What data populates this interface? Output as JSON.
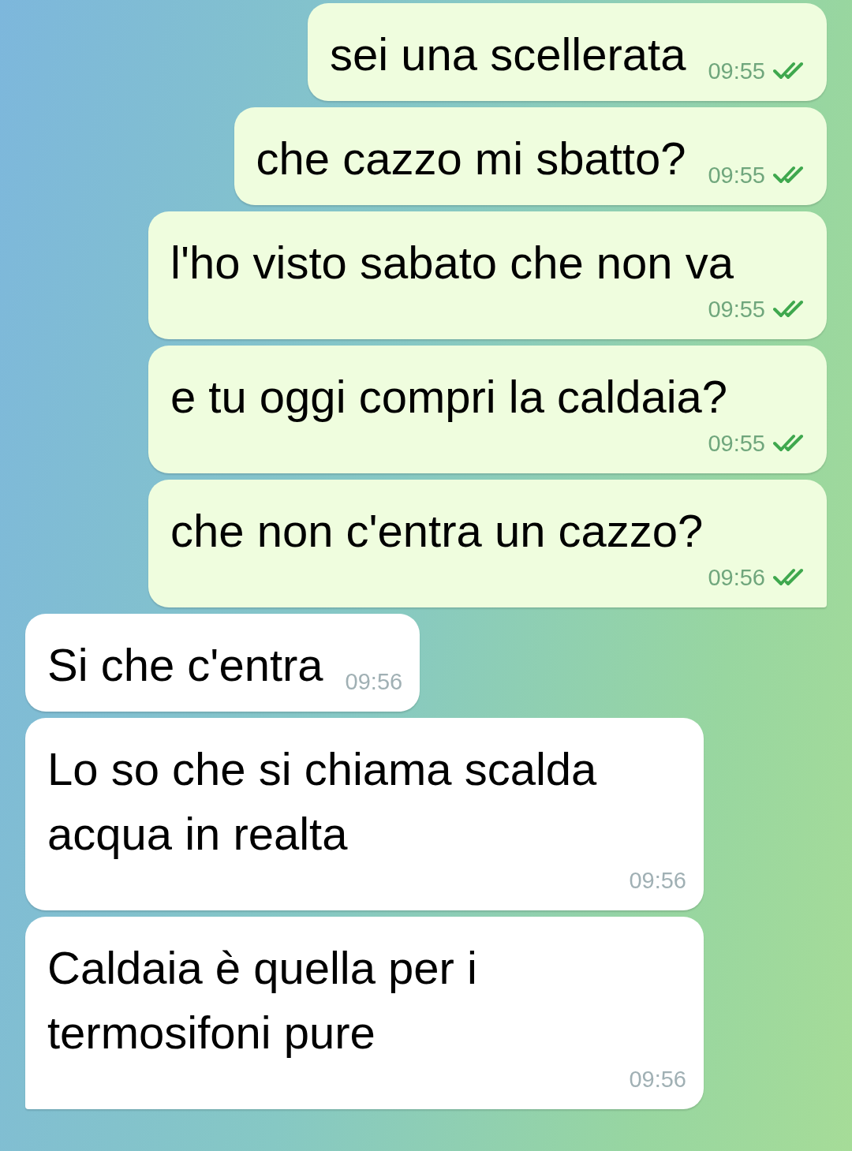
{
  "messages": [
    {
      "kind": "out",
      "text": "sei una scellerata",
      "time": "09:55",
      "read": true,
      "tail": false
    },
    {
      "kind": "out",
      "text": "che cazzo mi sbatto?",
      "time": "09:55",
      "read": true,
      "tail": false
    },
    {
      "kind": "out",
      "text": "l'ho visto sabato che non va",
      "time": "09:55",
      "read": true,
      "tail": false
    },
    {
      "kind": "out",
      "text": "e tu oggi compri la caldaia?",
      "time": "09:55",
      "read": true,
      "tail": false
    },
    {
      "kind": "out",
      "text": "che non c'entra un cazzo?",
      "time": "09:56",
      "read": true,
      "tail": true
    },
    {
      "kind": "in",
      "text": "Si che c'entra",
      "time": "09:56",
      "tail": false
    },
    {
      "kind": "in",
      "text": "Lo so che si chiama scalda acqua in realta",
      "time": "09:56",
      "tail": false
    },
    {
      "kind": "in",
      "text": "Caldaia è quella per i termosifoni pure",
      "time": "09:56",
      "tail": true
    }
  ]
}
